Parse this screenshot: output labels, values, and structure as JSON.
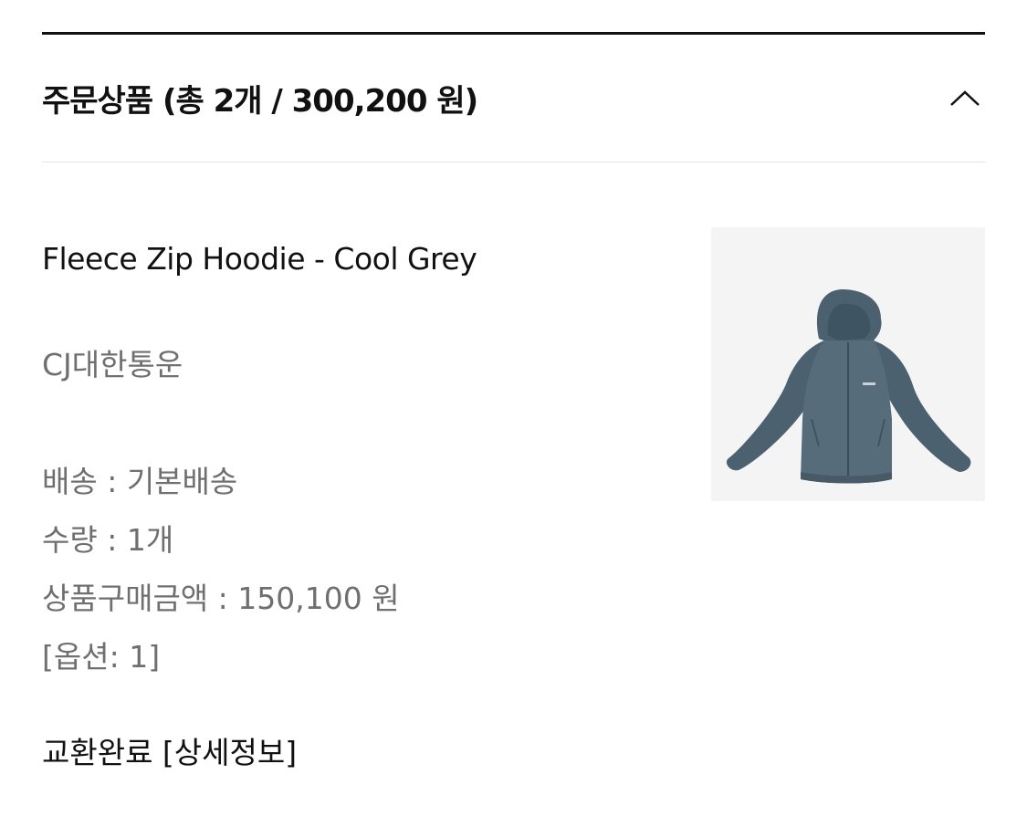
{
  "header": {
    "title": "주문상품 (총 2개 / 300,200 원)",
    "toggle_icon": "chevron-up-icon"
  },
  "product": {
    "name": "Fleece Zip Hoodie - Cool Grey",
    "courier": "CJ대한통운",
    "image_icon": "hoodie-image",
    "details": [
      "배송 : 기본배송",
      "수량 : 1개",
      "상품구매금액 : 150,100 원",
      "[옵션: 1]"
    ],
    "status": "교환완료 [상세정보]"
  },
  "colors": {
    "text_primary": "#111111",
    "text_secondary": "#6f6f6f",
    "divider": "#e4e4e4",
    "image_bg": "#f4f4f4",
    "hoodie": "#4b6170"
  }
}
